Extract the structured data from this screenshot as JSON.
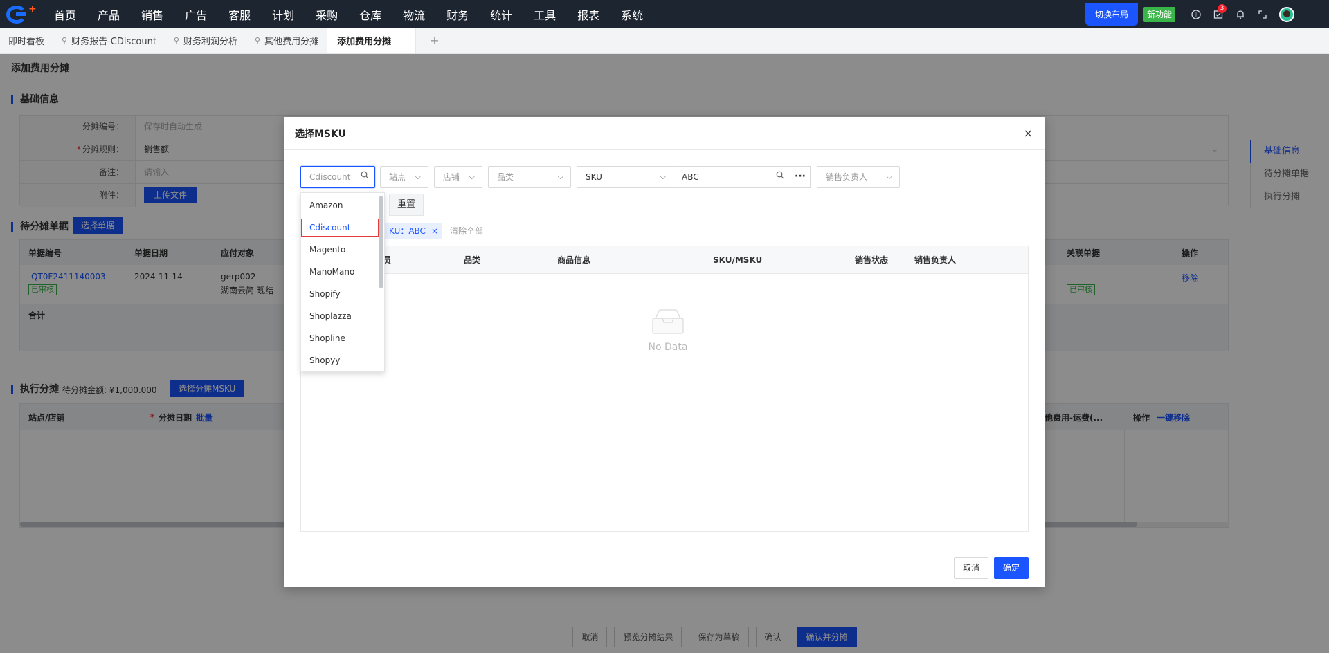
{
  "nav": {
    "items": [
      "首页",
      "产品",
      "销售",
      "广告",
      "客服",
      "计划",
      "采购",
      "仓库",
      "物流",
      "财务",
      "统计",
      "工具",
      "报表",
      "系统"
    ],
    "layout_btn": "切换布局",
    "new_btn": "新功能",
    "notify_count": "3",
    "icons": [
      "pause-circle-icon",
      "task-icon",
      "bell-icon",
      "expand-icon",
      "avatar"
    ]
  },
  "tabs": {
    "items": [
      "即时看板",
      "财务报告-CDiscount",
      "财务利润分析",
      "其他费用分摊",
      "添加费用分摊"
    ],
    "add": "+"
  },
  "page": {
    "title": "添加费用分摊",
    "basic": {
      "title": "基础信息",
      "fields": [
        {
          "label": "分摊编号：",
          "value": "保存时自动生成"
        },
        {
          "label": "分摊规则：",
          "value": "销售额",
          "required": "*"
        },
        {
          "label": "备注：",
          "value": "请输入"
        },
        {
          "label": "附件：",
          "value": "上传文件"
        }
      ]
    },
    "pending": {
      "title": "待分摊单据",
      "select_btn": "选择单据",
      "cols": [
        "单据编号",
        "单据日期",
        "应付对象",
        "关联单据",
        "操作"
      ],
      "row": {
        "no": "QT0F2411140003",
        "status": "已审核",
        "date": "2024-11-14",
        "target_1": "gerp002",
        "target_2": "湖南云简-现结",
        "related": "--",
        "related_status": "已审核",
        "action": "移除"
      },
      "total_label": "合计"
    },
    "exec": {
      "title": "执行分摊",
      "amount_label": "待分摊金额: ¥1,000.000",
      "select_btn": "选择分摊MSKU",
      "cols": [
        "站点/店铺",
        "分摊日期",
        "批量",
        "他费用-运费(...",
        "操作",
        "一键移除"
      ],
      "required": "*"
    },
    "anchors": [
      "基础信息",
      "待分摊单据",
      "执行分摊"
    ],
    "bottom": [
      "取消",
      "预览分摊结果",
      "保存为草稿",
      "确认",
      "确认并分摊"
    ]
  },
  "modal": {
    "title": "选择MSKU",
    "close": "×",
    "filters": {
      "platform": "Cdiscount",
      "site": "站点",
      "shop": "店铺",
      "category": "品类",
      "sku_type": "SKU",
      "sku_value": "ABC",
      "more": "···",
      "owner": "销售负责人"
    },
    "reset": "重置",
    "chip": "KU：ABC",
    "chip_close": "×",
    "clear_all": "清除全部",
    "cols": [
      "员",
      "品类",
      "商品信息",
      "SKU/MSKU",
      "销售状态",
      "销售负责人"
    ],
    "no_data": "No Data",
    "cancel": "取消",
    "confirm": "确定"
  },
  "dropdown": {
    "options": [
      "Amazon",
      "Cdiscount",
      "Magento",
      "ManoMano",
      "Shopify",
      "Shoplazza",
      "Shopline",
      "Shopyy"
    ],
    "selected": "Cdiscount"
  }
}
